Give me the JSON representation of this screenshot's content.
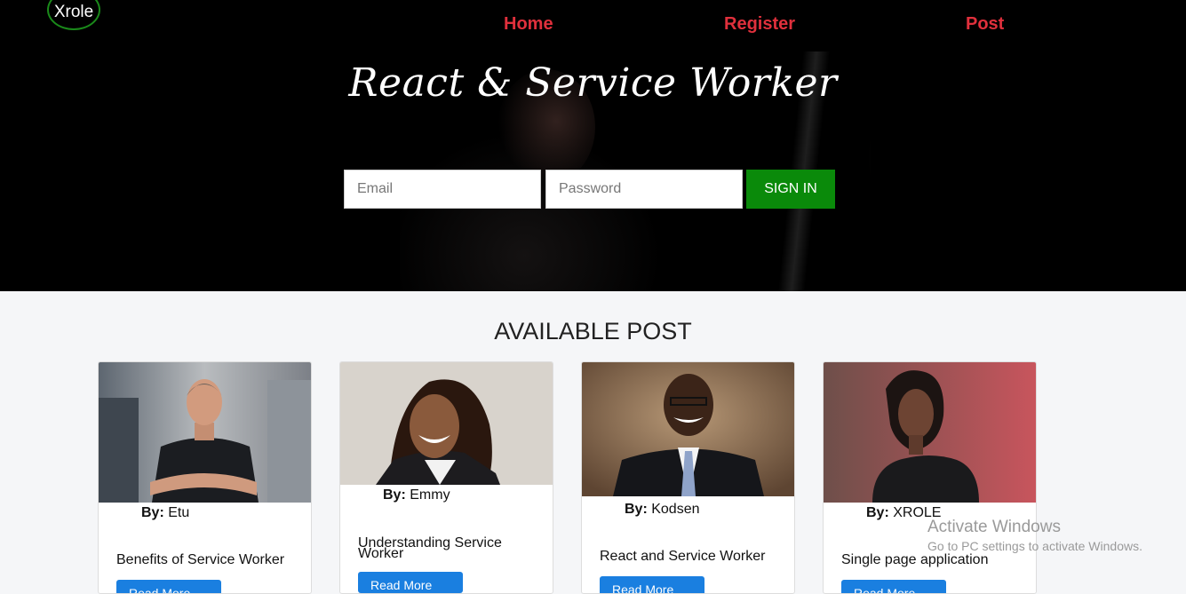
{
  "nav": {
    "logo": "Xrole",
    "home": "Home",
    "register": "Register",
    "post": "Post"
  },
  "hero": {
    "title": "React & Service Worker",
    "email_placeholder": "Email",
    "password_placeholder": "Password",
    "signin_label": "SIGN IN"
  },
  "section": {
    "title": "AVAILABLE POST"
  },
  "posts": [
    {
      "by_label": "By:",
      "author": "Etu",
      "title": "Benefits of Service Worker",
      "button": "Read More"
    },
    {
      "by_label": "By:",
      "author": "Emmy",
      "title": "Understanding Service Worker",
      "button": "Read More"
    },
    {
      "by_label": "By:",
      "author": "Kodsen",
      "title": "React and Service Worker",
      "button": "Read More"
    },
    {
      "by_label": "By:",
      "author": "XROLE",
      "title": "Single page application",
      "button": "Read More"
    }
  ],
  "watermark": {
    "line1": "Activate Windows",
    "line2": "Go to PC settings to activate Windows."
  }
}
